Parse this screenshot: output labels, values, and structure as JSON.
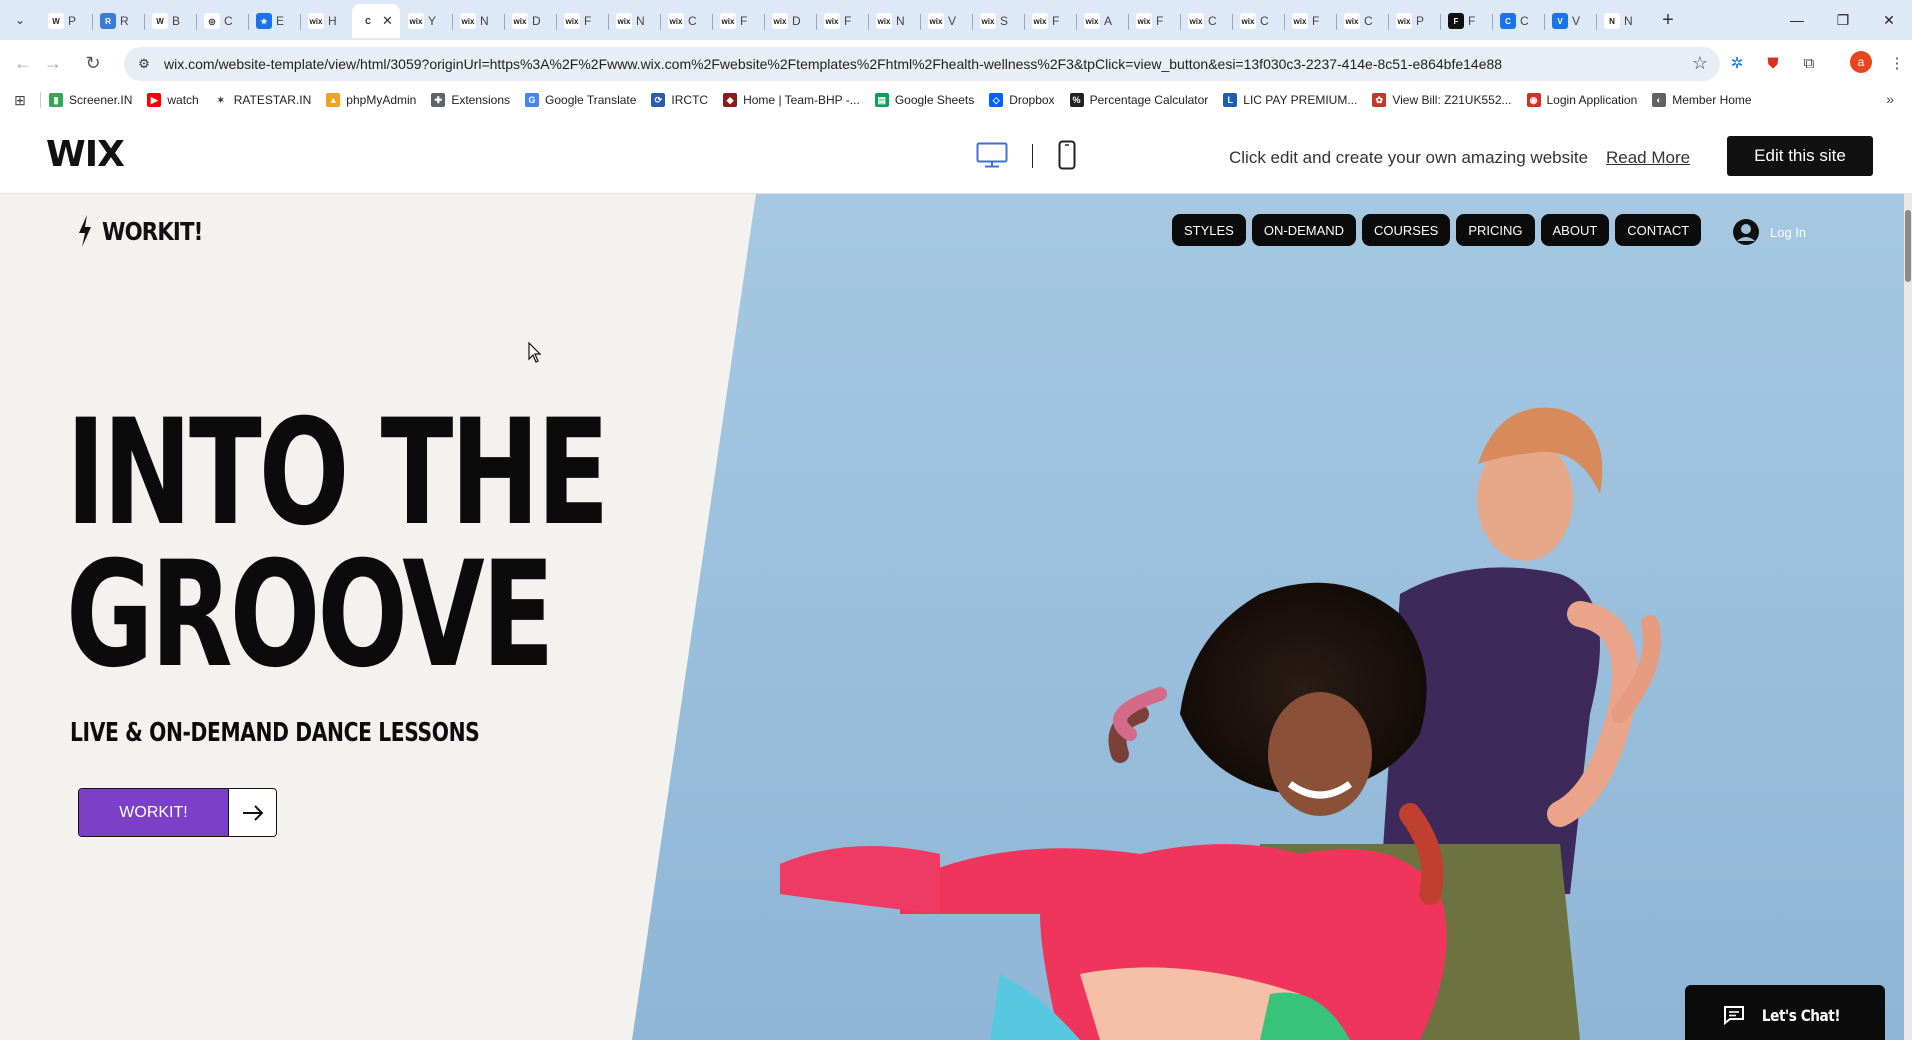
{
  "browser": {
    "tabs": [
      {
        "icon": "W",
        "title": "P",
        "color": "#ffffff"
      },
      {
        "icon": "R",
        "title": "R",
        "color": "#3b7bd8"
      },
      {
        "icon": "W",
        "title": "B",
        "color": "#ffffff"
      },
      {
        "icon": "◎",
        "title": "C",
        "color": "#ffffff"
      },
      {
        "icon": "★",
        "title": "E",
        "color": "#1a73e8"
      },
      {
        "icon": "wix",
        "title": "H",
        "color": "#ffffff"
      },
      {
        "icon": "wix",
        "title": "Y",
        "color": "#ffffff"
      },
      {
        "icon": "wix",
        "title": "N",
        "color": "#ffffff"
      },
      {
        "icon": "wix",
        "title": "D",
        "color": "#ffffff"
      },
      {
        "icon": "wix",
        "title": "F",
        "color": "#ffffff"
      },
      {
        "icon": "wix",
        "title": "N",
        "color": "#ffffff"
      },
      {
        "icon": "wix",
        "title": "C",
        "color": "#ffffff"
      },
      {
        "icon": "wix",
        "title": "F",
        "color": "#ffffff"
      },
      {
        "icon": "wix",
        "title": "D",
        "color": "#ffffff"
      },
      {
        "icon": "wix",
        "title": "F",
        "color": "#ffffff"
      },
      {
        "icon": "wix",
        "title": "N",
        "color": "#ffffff"
      },
      {
        "icon": "wix",
        "title": "V",
        "color": "#ffffff"
      },
      {
        "icon": "wix",
        "title": "S",
        "color": "#ffffff"
      },
      {
        "icon": "wix",
        "title": "F",
        "color": "#ffffff"
      },
      {
        "icon": "wix",
        "title": "A",
        "color": "#ffffff"
      },
      {
        "icon": "wix",
        "title": "F",
        "color": "#ffffff"
      },
      {
        "icon": "wix",
        "title": "C",
        "color": "#ffffff"
      },
      {
        "icon": "wix",
        "title": "C",
        "color": "#ffffff"
      },
      {
        "icon": "wix",
        "title": "F",
        "color": "#ffffff"
      },
      {
        "icon": "wix",
        "title": "C",
        "color": "#ffffff"
      },
      {
        "icon": "wix",
        "title": "P",
        "color": "#ffffff"
      },
      {
        "icon": "F",
        "title": "F",
        "color": "#111111"
      },
      {
        "icon": "C",
        "title": "C",
        "color": "#1a73e8"
      },
      {
        "icon": "V",
        "title": "V",
        "color": "#1a73e8"
      },
      {
        "icon": "N",
        "title": "N",
        "color": "#ffffff"
      }
    ],
    "active_tab": {
      "icon": "C",
      "title": "C"
    },
    "url": "wix.com/website-template/view/html/3059?originUrl=https%3A%2F%2Fwww.wix.com%2Fwebsite%2Ftemplates%2Fhtml%2Fhealth-wellness%2F3&tpClick=view_button&esi=13f030c3-2237-414e-8c51-e864bfe14e88",
    "profile_initial": "a",
    "bookmarks": [
      {
        "label": "Screener.IN",
        "icon_color": "#34a853",
        "icon": "▮"
      },
      {
        "label": "watch",
        "icon_color": "#ff0000",
        "icon": "▶"
      },
      {
        "label": "RATESTAR.IN",
        "icon_color": "#ffffff",
        "icon": "✶"
      },
      {
        "label": "phpMyAdmin",
        "icon_color": "#f4a020",
        "icon": "▲"
      },
      {
        "label": "Extensions",
        "icon_color": "#5f6368",
        "icon": "✚"
      },
      {
        "label": "Google Translate",
        "icon_color": "#4285f4",
        "icon": "G"
      },
      {
        "label": "IRCTC",
        "icon_color": "#2a5db0",
        "icon": "⟳"
      },
      {
        "label": "Home | Team-BHP -...",
        "icon_color": "#8b1a1a",
        "icon": "◆"
      },
      {
        "label": "Google Sheets",
        "icon_color": "#0f9d58",
        "icon": "▤"
      },
      {
        "label": "Dropbox",
        "icon_color": "#0061ff",
        "icon": "◇"
      },
      {
        "label": "Percentage Calculator",
        "icon_color": "#222222",
        "icon": "%"
      },
      {
        "label": "LIC PAY PREMIUM...",
        "icon_color": "#1a5fb4",
        "icon": "L"
      },
      {
        "label": "View Bill: Z21UK552...",
        "icon_color": "#c0392b",
        "icon": "✿"
      },
      {
        "label": "Login Application",
        "icon_color": "#d93025",
        "icon": "◉"
      },
      {
        "label": "Member Home",
        "icon_color": "#5f6368",
        "icon": "◐"
      }
    ]
  },
  "wix_header": {
    "logo": "WIX",
    "message": "Click edit and create your own amazing website",
    "read_more": "Read More",
    "edit_button": "Edit this site"
  },
  "site": {
    "brand": "WORKIT!",
    "nav": [
      "STYLES",
      "ON-DEMAND",
      "COURSES",
      "PRICING",
      "ABOUT",
      "CONTACT"
    ],
    "login": "Log In",
    "headline_line1": "INTO THE",
    "headline_line2": "GROOVE",
    "subheadline": "LIVE & ON-DEMAND DANCE LESSONS",
    "cta": "WORKIT!",
    "chat": "Let's Chat!",
    "colors": {
      "accent": "#7b3fc8",
      "panel": "#f3f2ee",
      "sky": "#9fc3df"
    }
  }
}
